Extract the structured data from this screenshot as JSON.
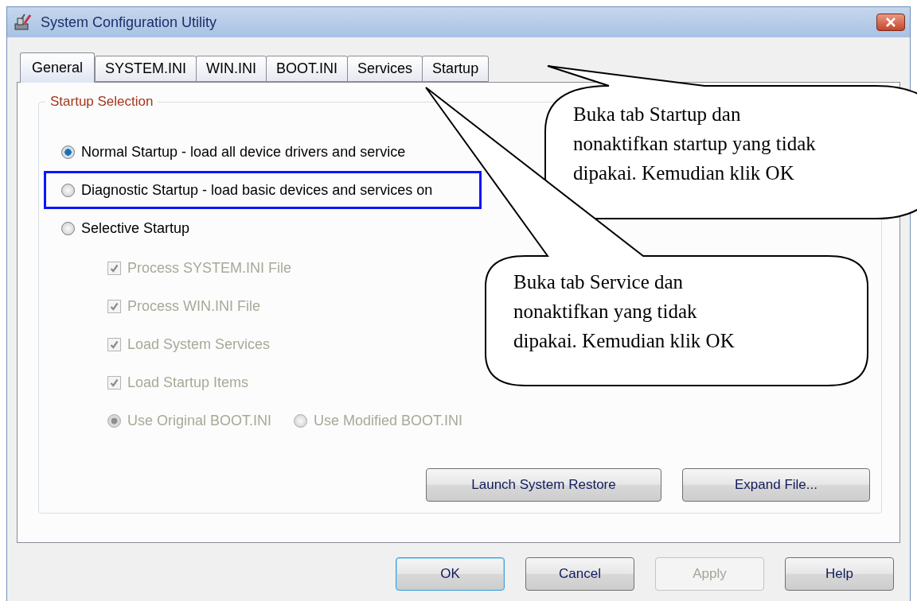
{
  "window": {
    "title": "System Configuration Utility"
  },
  "tabs": [
    {
      "label": "General",
      "selected": true
    },
    {
      "label": "SYSTEM.INI",
      "selected": false
    },
    {
      "label": "WIN.INI",
      "selected": false
    },
    {
      "label": "BOOT.INI",
      "selected": false
    },
    {
      "label": "Services",
      "selected": false
    },
    {
      "label": "Startup",
      "selected": false
    }
  ],
  "startup_selection": {
    "title": "Startup Selection",
    "modes": [
      {
        "label": "Normal Startup - load all device drivers and service",
        "selected": true,
        "highlighted": false
      },
      {
        "label": "Diagnostic Startup - load basic devices and services on",
        "selected": false,
        "highlighted": true
      },
      {
        "label": "Selective Startup",
        "selected": false,
        "highlighted": false
      }
    ],
    "selective_options": [
      {
        "label": "Process SYSTEM.INI File",
        "checked": true,
        "disabled": true
      },
      {
        "label": "Process WIN.INI File",
        "checked": true,
        "disabled": true
      },
      {
        "label": "Load System Services",
        "checked": true,
        "disabled": true
      },
      {
        "label": "Load Startup Items",
        "checked": true,
        "disabled": true
      }
    ],
    "boot_ini_options": [
      {
        "label": "Use Original BOOT.INI",
        "selected": true,
        "disabled": true
      },
      {
        "label": "Use Modified BOOT.INI",
        "selected": false,
        "disabled": true
      }
    ]
  },
  "panel_buttons": [
    {
      "label": "Launch System Restore",
      "disabled": false
    },
    {
      "label": "Expand File...",
      "disabled": false
    }
  ],
  "dialog_buttons": [
    {
      "label": "OK",
      "default": true,
      "disabled": false
    },
    {
      "label": "Cancel",
      "default": false,
      "disabled": false
    },
    {
      "label": "Apply",
      "default": false,
      "disabled": true
    },
    {
      "label": "Help",
      "default": false,
      "disabled": false
    }
  ],
  "callouts": [
    {
      "text": "Buka tab Startup dan\nnonaktifkan startup yang tidak\ndipakai. Kemudian klik OK"
    },
    {
      "text": "Buka tab Service dan\nnonaktifkan yang tidak\ndipakai. Kemudian klik OK"
    }
  ]
}
